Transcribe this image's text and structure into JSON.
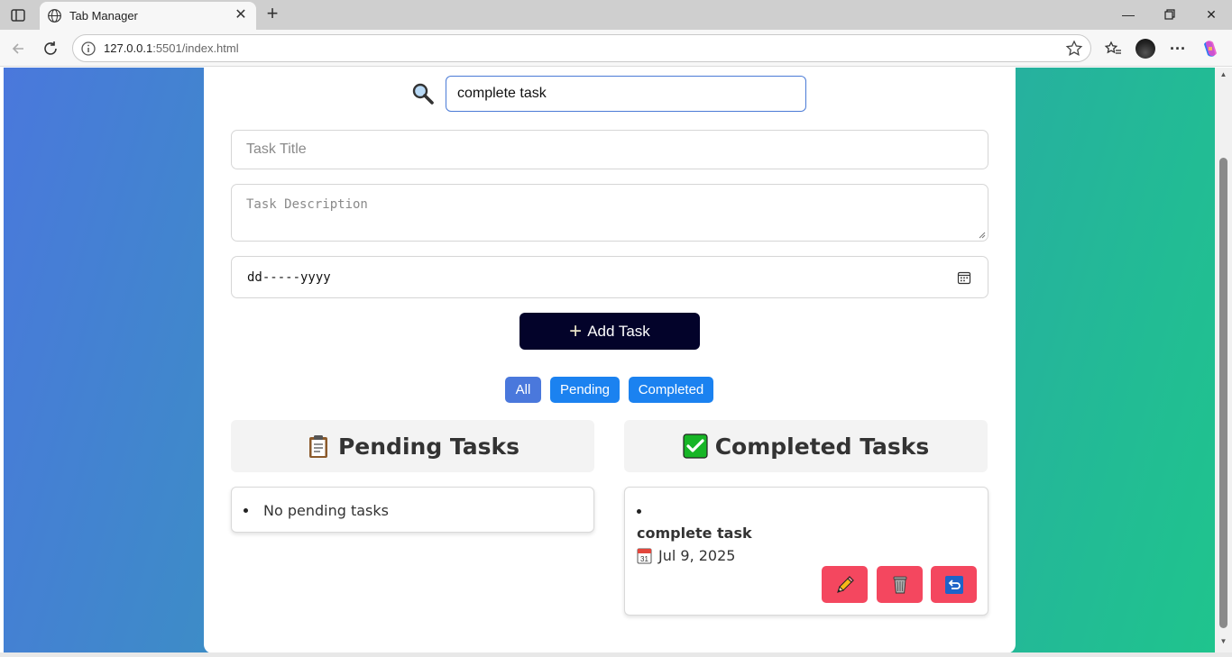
{
  "browser": {
    "tab_title": "Tab Manager",
    "url_host": "127.0.0.1",
    "url_path": ":5501/index.html",
    "icons": [
      "sidebar-icon",
      "globe-icon",
      "close-icon",
      "plus-icon",
      "minimize-icon",
      "maximize-icon",
      "close-window-icon",
      "back-icon",
      "reload-icon",
      "info-icon",
      "star-icon",
      "favorites-icon",
      "profile-avatar",
      "more-icon",
      "copilot-icon"
    ]
  },
  "search": {
    "value": "complete task",
    "icon": "magnifier-icon"
  },
  "form": {
    "title_placeholder": "Task Title",
    "description_placeholder": "Task Description",
    "date_placeholder": "dd-----yyyy",
    "add_button_label": "Add Task"
  },
  "filters": {
    "all": "All",
    "pending": "Pending",
    "completed": "Completed"
  },
  "pending_panel": {
    "title": "Pending Tasks",
    "empty_message": "No pending tasks",
    "icon": "clipboard-icon"
  },
  "completed_panel": {
    "title": "Completed Tasks",
    "icon": "check-mark-icon",
    "tasks": [
      {
        "title": "complete task",
        "date": "Jul 9, 2025",
        "actions": [
          "pencil-icon",
          "wastebasket-icon",
          "undo-icon"
        ]
      }
    ]
  },
  "colors": {
    "gradient_start": "#4a78dc",
    "gradient_end": "#1fc48d",
    "add_button": "#03032a",
    "filter_active": "#4a78dc",
    "filter": "#1b82f0",
    "action_button": "#f4475f"
  }
}
